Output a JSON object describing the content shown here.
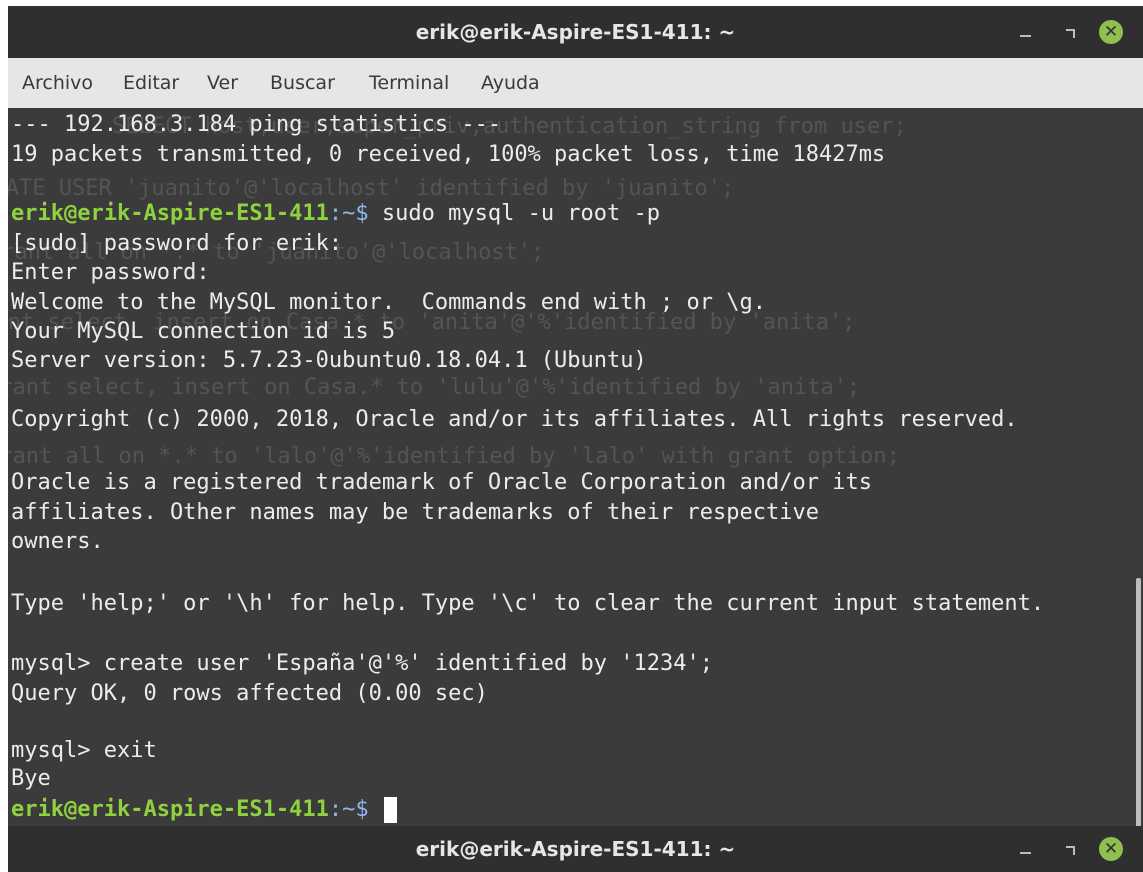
{
  "window": {
    "title": "erik@erik-Aspire-ES1-411: ~",
    "close_glyph": "✕"
  },
  "menu": [
    "Archivo",
    "Editar",
    "Ver",
    "Buscar",
    "Terminal",
    "Ayuda"
  ],
  "ghost_lines": [
    "SELECT host,user,super_priv,authentication_string from user;",
    "CREATE USER 'juanito'@'localhost' identified by 'juanito';",
    "grant all on *.* to 'juanito'@'localhost';",
    "grant select, insert on Casa.* to 'anita'@'%'identified by 'anita';",
    "grant select, insert on Casa.* to 'lulu'@'%'identified by 'anita';",
    "grant all on *.* to 'lalo'@'%'identified by 'lalo' with grant option;"
  ],
  "prompt": {
    "user_host": "erik@erik-Aspire-ES1-411",
    "path_sep": ":~$ "
  },
  "terminal": {
    "ping_header": "--- 192.168.3.184 ping statistics ---",
    "ping_stats": "19 packets transmitted, 0 received, 100% packet loss, time 18427ms",
    "cmd_mysql": "sudo mysql -u root -p",
    "sudo_pw": "[sudo] password for erik:",
    "enter_pw": "Enter password:",
    "welcome": "Welcome to the MySQL monitor.  Commands end with ; or \\g.",
    "conn_id": "Your MySQL connection id is 5",
    "server_version": "Server version: 5.7.23-0ubuntu0.18.04.1 (Ubuntu)",
    "copyright": "Copyright (c) 2000, 2018, Oracle and/or its affiliates. All rights reserved.",
    "oracle1": "Oracle is a registered trademark of Oracle Corporation and/or its",
    "oracle2": "affiliates. Other names may be trademarks of their respective",
    "oracle3": "owners.",
    "help": "Type 'help;' or '\\h' for help. Type '\\c' to clear the current input statement.",
    "create_user": "mysql> create user 'España'@'%' identified by '1234';",
    "query_ok": "Query OK, 0 rows affected (0.00 sec)",
    "exit_cmd": "mysql> exit",
    "bye": "Bye"
  }
}
